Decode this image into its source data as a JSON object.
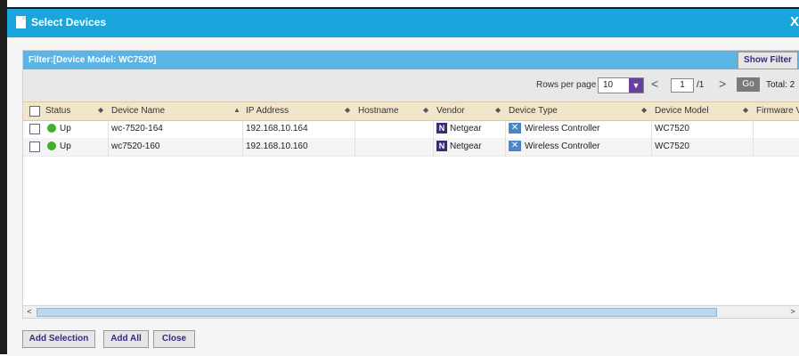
{
  "dialog": {
    "title": "Select Devices",
    "close": "X"
  },
  "filter": {
    "text": "Filter:[Device Model: WC7520]",
    "show_filter_label": "Show Filter"
  },
  "pager": {
    "rows_per_page_label": "Rows per page",
    "rows_per_page_value": "10",
    "prev": "<",
    "page": "1",
    "of_pages": "/1",
    "next": ">",
    "go_label": "Go",
    "total_label": "Total: 2"
  },
  "columns": [
    "Status",
    "Device Name",
    "IP Address",
    "Hostname",
    "Vendor",
    "Device Type",
    "Device Model",
    "Firmware V"
  ],
  "rows": [
    {
      "status": "Up",
      "device_name": "wc-7520-164",
      "ip": "192.168.10.164",
      "hostname": "",
      "vendor": "Netgear",
      "device_type": "Wireless Controller",
      "device_model": "WC7520"
    },
    {
      "status": "Up",
      "device_name": "wc7520-160",
      "ip": "192.168.10.160",
      "hostname": "",
      "vendor": "Netgear",
      "device_type": "Wireless Controller",
      "device_model": "WC7520"
    }
  ],
  "icons": {
    "vendor_icon_letter": "N",
    "device_type_icon_glyph": "✕",
    "dropdown_glyph": "▼",
    "sort_glyph": "◆",
    "sort_asc_glyph": "▲",
    "scroll_left": "<",
    "scroll_right": ">"
  },
  "footer": {
    "add_selection": "Add Selection",
    "add_all": "Add All",
    "close": "Close"
  },
  "colors": {
    "title_bar": "#1aa6dc",
    "filter_bar": "#5cb4e2",
    "header_row": "#f1e6c9",
    "status_up": "#3fae29",
    "accent_purple": "#6a3fa0"
  }
}
